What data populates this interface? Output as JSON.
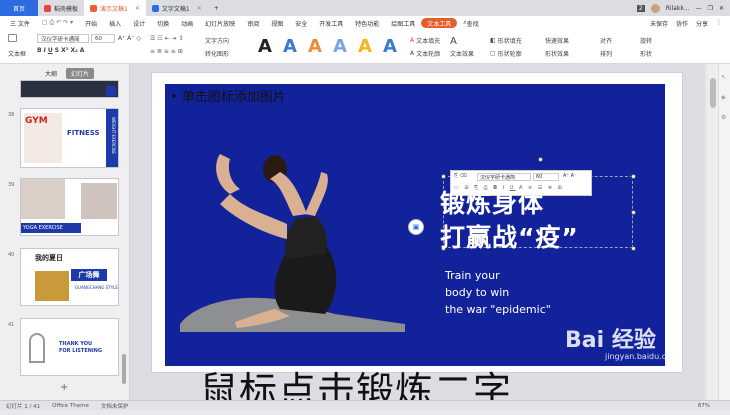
{
  "tabs": {
    "home": "首页",
    "templates": "稻壳模板",
    "presentation": "演示文稿1",
    "document": "文字文稿1",
    "user": "Rilakk..."
  },
  "menu": {
    "file": "三 文件",
    "items": [
      "开始",
      "插入",
      "设计",
      "切换",
      "动画",
      "幻灯片放映",
      "审阅",
      "视图",
      "安全",
      "开发工具",
      "特色功能",
      "绘图工具",
      "文本工具"
    ],
    "search": "查找",
    "unsaved": "未保存",
    "collaborate": "协作",
    "share": "分享"
  },
  "ribbon": {
    "textbox": "文本框",
    "font": "汉仪字研卡通简",
    "size": "60",
    "art_letter": "A",
    "fill": "文本填充",
    "outline": "文本轮廓",
    "effect": "文本效果",
    "shape_fill": "形状填充",
    "shape_outline": "形状轮廓",
    "shape_effect": "形状效果",
    "quick": "快速效果",
    "align": "对齐",
    "arrange": "排列",
    "rotate": "旋转",
    "rows": "填",
    "wrap": "换",
    "columns": "栏",
    "textdir": "文字方向",
    "bullets": "转化图形",
    "smart": "形状"
  },
  "art_colors": [
    "#222222",
    "#3a78d6",
    "#ef8b3a",
    "#7aa6e0",
    "#f2b61a",
    "#3a78d6"
  ],
  "sidebar": {
    "tab_outline": "大纲",
    "tab_slides": "幻灯片",
    "slides": [
      {
        "num": "38",
        "lines": [
          "GYM",
          "FITNESS",
          "WEIGHT EXERCISE"
        ]
      },
      {
        "num": "39",
        "lines": [
          "YOGA EXERCISE"
        ]
      },
      {
        "num": "40",
        "lines": [
          "我的夏日",
          "广场舞",
          "GUANGCHANG STYLE"
        ]
      },
      {
        "num": "41",
        "lines": [
          "THANK YOU",
          "FOR LISTENING"
        ]
      }
    ],
    "add": "+"
  },
  "slide": {
    "placeholder": "• 单击图标添加图片",
    "title_line1": "锻炼身体",
    "title_line2": "打赢战“疫”",
    "sub1": "Train your",
    "sub2": "body to win",
    "sub3": "the war \"epidemic\"",
    "mini_font": "汉仪字研卡通简",
    "mini_size": "60"
  },
  "caption": "鼠标点击锻炼二字",
  "status": {
    "slide": "幻灯片 1 / 41",
    "theme": "Office Theme",
    "protect": "文档未保护",
    "zoom": "87%"
  },
  "watermark": "Bai 经验",
  "watermark_url": "jingyan.baidu.com"
}
